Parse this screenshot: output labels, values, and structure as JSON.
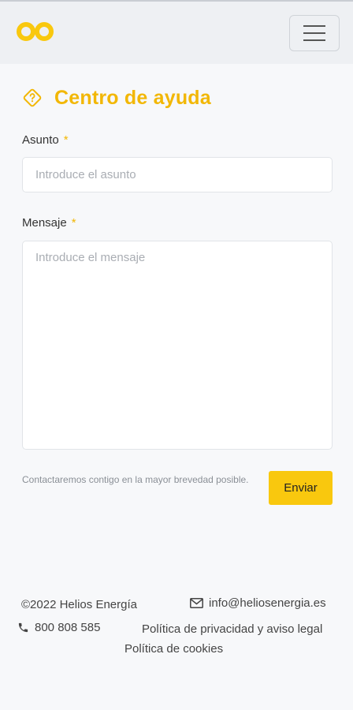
{
  "header": {
    "logo_icon": "helios-logo-icon",
    "menu_icon": "hamburger-menu-icon",
    "accent_color": "#f2b705"
  },
  "main": {
    "title_icon": "help-diamond-icon",
    "title": "Centro de ayuda",
    "subject": {
      "label": "Asunto",
      "required_mark": "*",
      "placeholder": "Introduce el asunto",
      "value": ""
    },
    "message": {
      "label": "Mensaje",
      "required_mark": "*",
      "placeholder": "Introduce el mensaje",
      "value": ""
    },
    "note": "Contactaremos contigo en la mayor brevedad posible.",
    "submit_label": "Enviar",
    "submit_color": "#f9c80e"
  },
  "footer": {
    "copyright": "©2022 Helios Energía",
    "email_icon": "envelope-icon",
    "email": "info@heliosenergia.es",
    "phone_icon": "phone-icon",
    "phone": "800 808 585",
    "privacy_link": "Política de privacidad y aviso legal",
    "cookies_link": "Política de cookies"
  }
}
